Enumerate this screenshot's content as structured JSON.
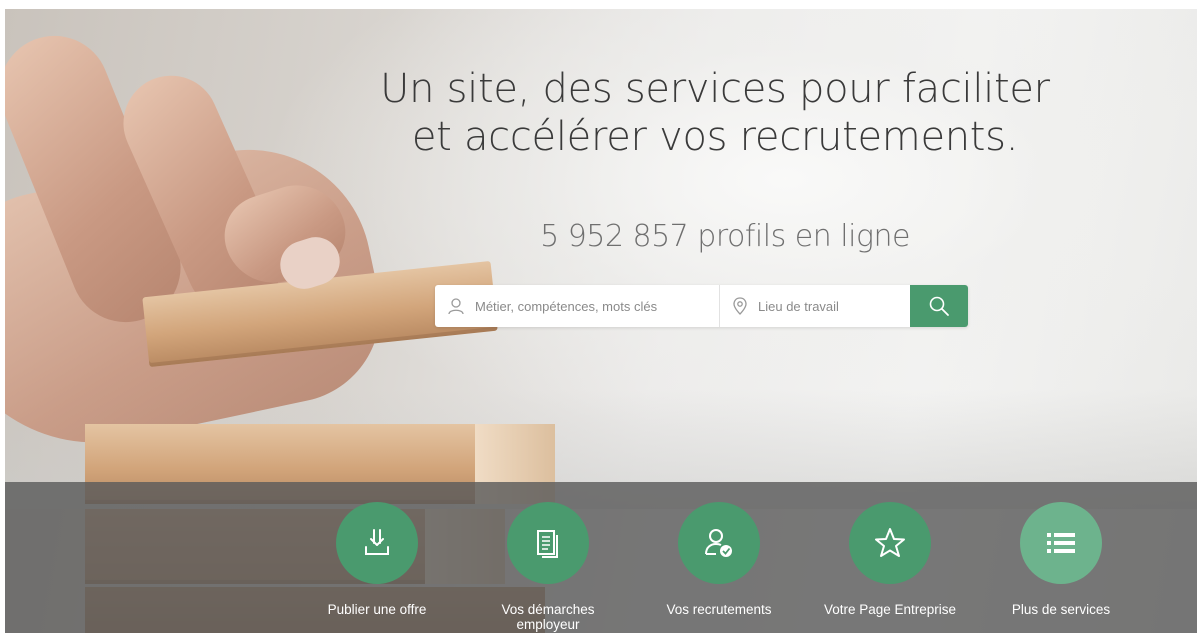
{
  "hero": {
    "headline_line1": "Un site, des services pour faciliter",
    "headline_line2": "et accélérer vos recrutements.",
    "profile_count": "5 952 857 profils en ligne"
  },
  "search": {
    "what_placeholder": "Métier, compétences, mots clés",
    "where_placeholder": "Lieu de travail",
    "button_icon": "search-icon"
  },
  "services": [
    {
      "label": "Publier une offre",
      "icon": "download-icon"
    },
    {
      "label": "Vos démarches employeur",
      "icon": "document-icon"
    },
    {
      "label": "Vos recrutements",
      "icon": "user-check-icon"
    },
    {
      "label": "Votre Page Entreprise",
      "icon": "star-icon"
    },
    {
      "label": "Plus de services",
      "icon": "list-icon"
    }
  ],
  "colors": {
    "accent": "#4a9a6e",
    "accent_light": "#6db38d",
    "band": "#5c5c5c"
  }
}
